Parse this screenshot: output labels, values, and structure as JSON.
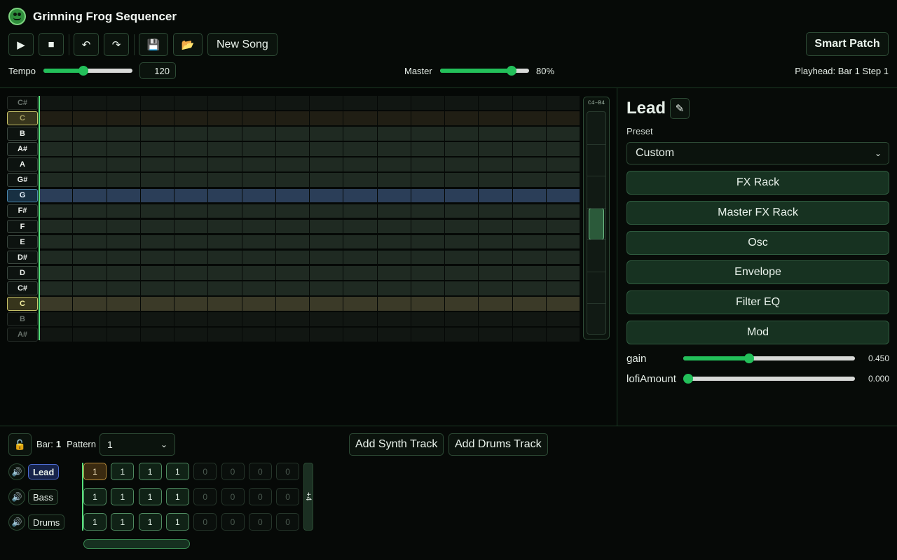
{
  "app": {
    "title": "Grinning Frog Sequencer"
  },
  "toolbar": {
    "play_icon": "▶",
    "stop_icon": "■",
    "undo_icon": "↶",
    "redo_icon": "↷",
    "save_icon": "💾",
    "open_icon": "📂",
    "new_song_label": "New Song",
    "smart_patch_label": "Smart Patch"
  },
  "transport": {
    "tempo_label": "Tempo",
    "tempo_value": "120",
    "tempo_fraction": 0.45,
    "master_label": "Master",
    "master_value": "80%",
    "master_fraction": 0.8,
    "playhead_text": "Playhead: Bar 1 Step 1"
  },
  "piano_roll": {
    "range_label": "C4–B4",
    "keys": [
      "C#",
      "C",
      "B",
      "A#",
      "A",
      "G#",
      "G",
      "F#",
      "F",
      "E",
      "D#",
      "D",
      "C#",
      "C",
      "B",
      "A#"
    ],
    "dim_keys": [
      0,
      1,
      14,
      15
    ],
    "c_keys": [
      1,
      13
    ],
    "selected_key": 6,
    "steps": 16
  },
  "instrument": {
    "name": "Lead",
    "edit_icon": "✎",
    "preset_label": "Preset",
    "preset_value": "Custom",
    "racks": [
      "FX Rack",
      "Master FX Rack",
      "Osc",
      "Envelope",
      "Filter EQ",
      "Mod"
    ],
    "params": [
      {
        "name": "gain",
        "value": "0.450",
        "fraction": 0.385
      },
      {
        "name": "lofiAmount",
        "value": "0.000",
        "fraction": 0.0
      }
    ]
  },
  "arranger": {
    "lock_icon": "🔓",
    "bar_label": "Bar:",
    "bar_value": "1",
    "pattern_label": "Pattern",
    "pattern_value": "1",
    "add_synth_label": "Add Synth Track",
    "add_drums_label": "Add Drums Track",
    "add_bar_label": "+4",
    "mute_icon": "🔊",
    "tracks": [
      {
        "name": "Lead",
        "patterns": [
          "1",
          "1",
          "1",
          "1",
          "0",
          "0",
          "0",
          "0"
        ]
      },
      {
        "name": "Bass",
        "patterns": [
          "1",
          "1",
          "1",
          "1",
          "0",
          "0",
          "0",
          "0"
        ]
      },
      {
        "name": "Drums",
        "patterns": [
          "1",
          "1",
          "1",
          "1",
          "0",
          "0",
          "0",
          "0"
        ]
      }
    ]
  },
  "colors": {
    "accent": "#23c05a",
    "playhead": "#56e07c",
    "selected_row": "#2b3e58",
    "c_row": "#3b3a28"
  }
}
